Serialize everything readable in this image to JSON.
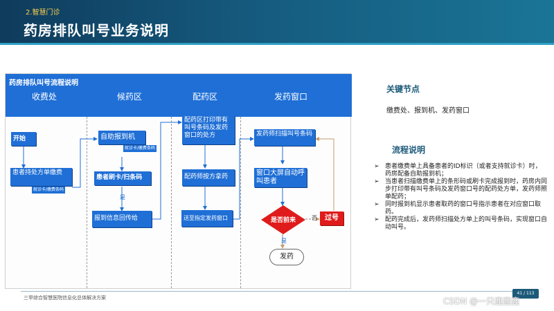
{
  "header": {
    "section_tag": "2.智慧门诊",
    "title": "药房排队叫号业务说明"
  },
  "flowchart": {
    "title": "药房排队叫号流程说明",
    "lanes": [
      "收费处",
      "候药区",
      "配药区",
      "发药窗口"
    ],
    "nodes": {
      "start": "开始",
      "patient_pay": "患者持处方单缴费",
      "card_pay_tag": "就诊卡/缴费条码",
      "self_checkin": "自助报到机",
      "card_tag": "就诊卡/缴费条码",
      "swipe_scan": "患者刷卡/扫条码",
      "report_his": "报到信息回传给HIS",
      "print_slip": "配药区打印带有叫号条码及发药窗口的处方",
      "dispense_by_slip": "配药师按方拿药",
      "deliver_window": "送至指定发药窗口",
      "scan_code": "发药师扫描叫号条码",
      "screen_call": "窗口大屏自动呼叫患者",
      "decision": "是否前来",
      "overdue": "过号",
      "dispense": "发药"
    },
    "edge_labels": {
      "yes1": "是",
      "yes2": "是",
      "no": "否"
    }
  },
  "key_nodes": {
    "title": "关键节点",
    "text": "缴费处、报到机、发药窗口"
  },
  "process_desc": {
    "title": "流程说明",
    "items": [
      "患者缴费单上具备患者的ID标识（或者支持就诊卡）时，药房配备自助报到机；",
      "当患者扫描缴费单上的条形码或刷卡完成报到时，药房内同步打印带有叫号条码及发药窗口号的配药处方单，发药师照单配药；",
      "同时报到机显示患者取药的窗口号指示患者在对应窗口取药。",
      "配药完成后，发药师扫描处方单上的叫号条码，实现窗口自动叫号。"
    ]
  },
  "footer": {
    "text": "三甲综合智慧医院信息化总体解决方案",
    "page": "41 / 113",
    "watermark": "CSDN @一只鹿鹿鹿"
  },
  "colors": {
    "header_bg": "#155a7e",
    "flow_blue": "#1f6fd6",
    "decision_red": "#e01b1b",
    "section_tag": "#ffd24a"
  }
}
